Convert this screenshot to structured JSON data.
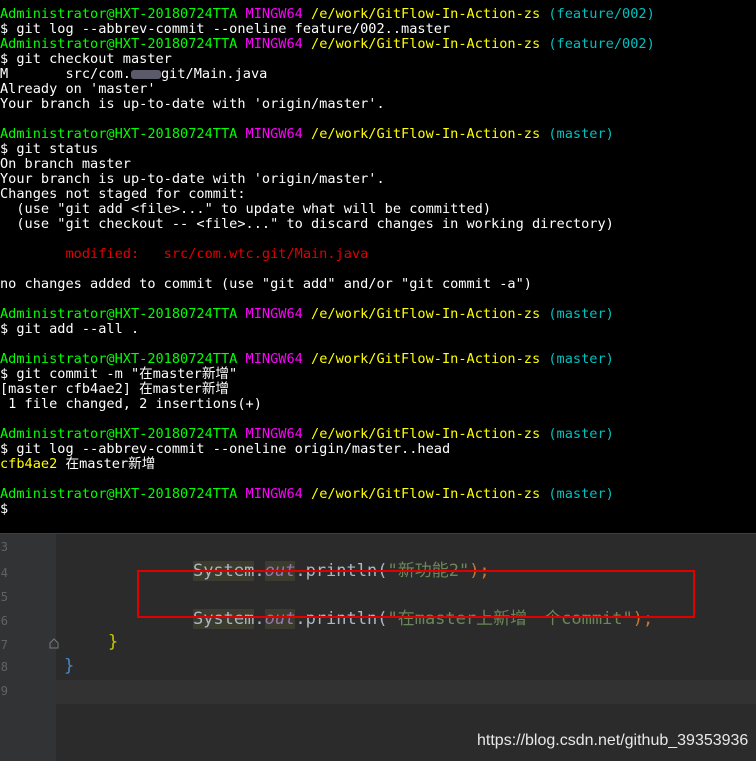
{
  "terminal": {
    "lines": [
      {
        "user": "Administrator@HXT-20180724TTA",
        "shell": "MINGW64",
        "path": "/e/work/GitFlow-In-Action-zs",
        "branch": "(feature/002)"
      },
      {
        "text": "$ git log --abbrev-commit --oneline feature/002..master"
      },
      {
        "user": "Administrator@HXT-20180724TTA",
        "shell": "MINGW64",
        "path": "/e/work/GitFlow-In-Action-zs",
        "branch": "(feature/002)"
      },
      {
        "text": "$ git checkout master"
      },
      {
        "mod_prefix": "M       src/com.",
        "mod_suffix": "git/Main.java"
      },
      {
        "text": "Already on 'master'"
      },
      {
        "text": "Your branch is up-to-date with 'origin/master'."
      },
      {
        "text": ""
      },
      {
        "user": "Administrator@HXT-20180724TTA",
        "shell": "MINGW64",
        "path": "/e/work/GitFlow-In-Action-zs",
        "branch": "(master)"
      },
      {
        "text": "$ git status"
      },
      {
        "text": "On branch master"
      },
      {
        "text": "Your branch is up-to-date with 'origin/master'."
      },
      {
        "text": "Changes not staged for commit:"
      },
      {
        "text": "  (use \"git add <file>...\" to update what will be committed)"
      },
      {
        "text": "  (use \"git checkout -- <file>...\" to discard changes in working directory)"
      },
      {
        "text": ""
      },
      {
        "red": "        modified:   src/com.wtc.git/Main.java"
      },
      {
        "text": ""
      },
      {
        "text": "no changes added to commit (use \"git add\" and/or \"git commit -a\")"
      },
      {
        "text": ""
      },
      {
        "user": "Administrator@HXT-20180724TTA",
        "shell": "MINGW64",
        "path": "/e/work/GitFlow-In-Action-zs",
        "branch": "(master)"
      },
      {
        "text": "$ git add --all ."
      },
      {
        "text": ""
      },
      {
        "user": "Administrator@HXT-20180724TTA",
        "shell": "MINGW64",
        "path": "/e/work/GitFlow-In-Action-zs",
        "branch": "(master)"
      },
      {
        "text": "$ git commit -m \"在master新增\""
      },
      {
        "text": "[master cfb4ae2] 在master新增"
      },
      {
        "text": " 1 file changed, 2 insertions(+)"
      },
      {
        "text": ""
      },
      {
        "user": "Administrator@HXT-20180724TTA",
        "shell": "MINGW64",
        "path": "/e/work/GitFlow-In-Action-zs",
        "branch": "(master)"
      },
      {
        "text": "$ git log --abbrev-commit --oneline origin/master..head"
      },
      {
        "hash": "cfb4ae2",
        "msg": " 在master新增"
      },
      {
        "text": ""
      },
      {
        "user": "Administrator@HXT-20180724TTA",
        "shell": "MINGW64",
        "path": "/e/work/GitFlow-In-Action-zs",
        "branch": "(master)"
      },
      {
        "text": "$"
      }
    ]
  },
  "editor": {
    "line_numbers": [
      "3",
      "4",
      "5",
      "6",
      "7",
      "8",
      "9"
    ],
    "code": [
      {
        "cls": "System",
        "dot1": ".",
        "fld": "out",
        "dot2": ".println(",
        "str": "\"新功能2\"",
        "end": ");"
      },
      {
        "cls": "System",
        "dot1": ".",
        "fld": "out",
        "dot2": ".println(",
        "str": "\"在master上新增一个commit\"",
        "end": ");"
      }
    ],
    "brace_inner": "}",
    "brace_outer": "}"
  },
  "watermark": "https://blog.csdn.net/github_39353936",
  "colors": {
    "prompt_user": "#00ff00",
    "prompt_shell": "#ff00ff",
    "prompt_path": "#ffff00",
    "prompt_branch": "#00c0c0",
    "modified": "#e00000",
    "highlight_box": "#e00000"
  }
}
